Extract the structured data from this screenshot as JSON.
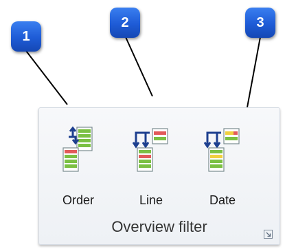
{
  "callouts": [
    "1",
    "2",
    "3"
  ],
  "ribbon_group": {
    "title": "Overview filter",
    "buttons": [
      {
        "label": "Order",
        "icon": "order-filter-icon"
      },
      {
        "label": "Line",
        "icon": "line-filter-icon"
      },
      {
        "label": "Date",
        "icon": "date-filter-icon"
      }
    ],
    "launcher_icon": "dialog-launcher-icon"
  },
  "colors": {
    "callout": "#1e5bd6",
    "row_red": "#e25a5a",
    "row_green": "#7bc043",
    "row_yellow": "#f0d040",
    "arrow_blue": "#1d3f8f"
  }
}
